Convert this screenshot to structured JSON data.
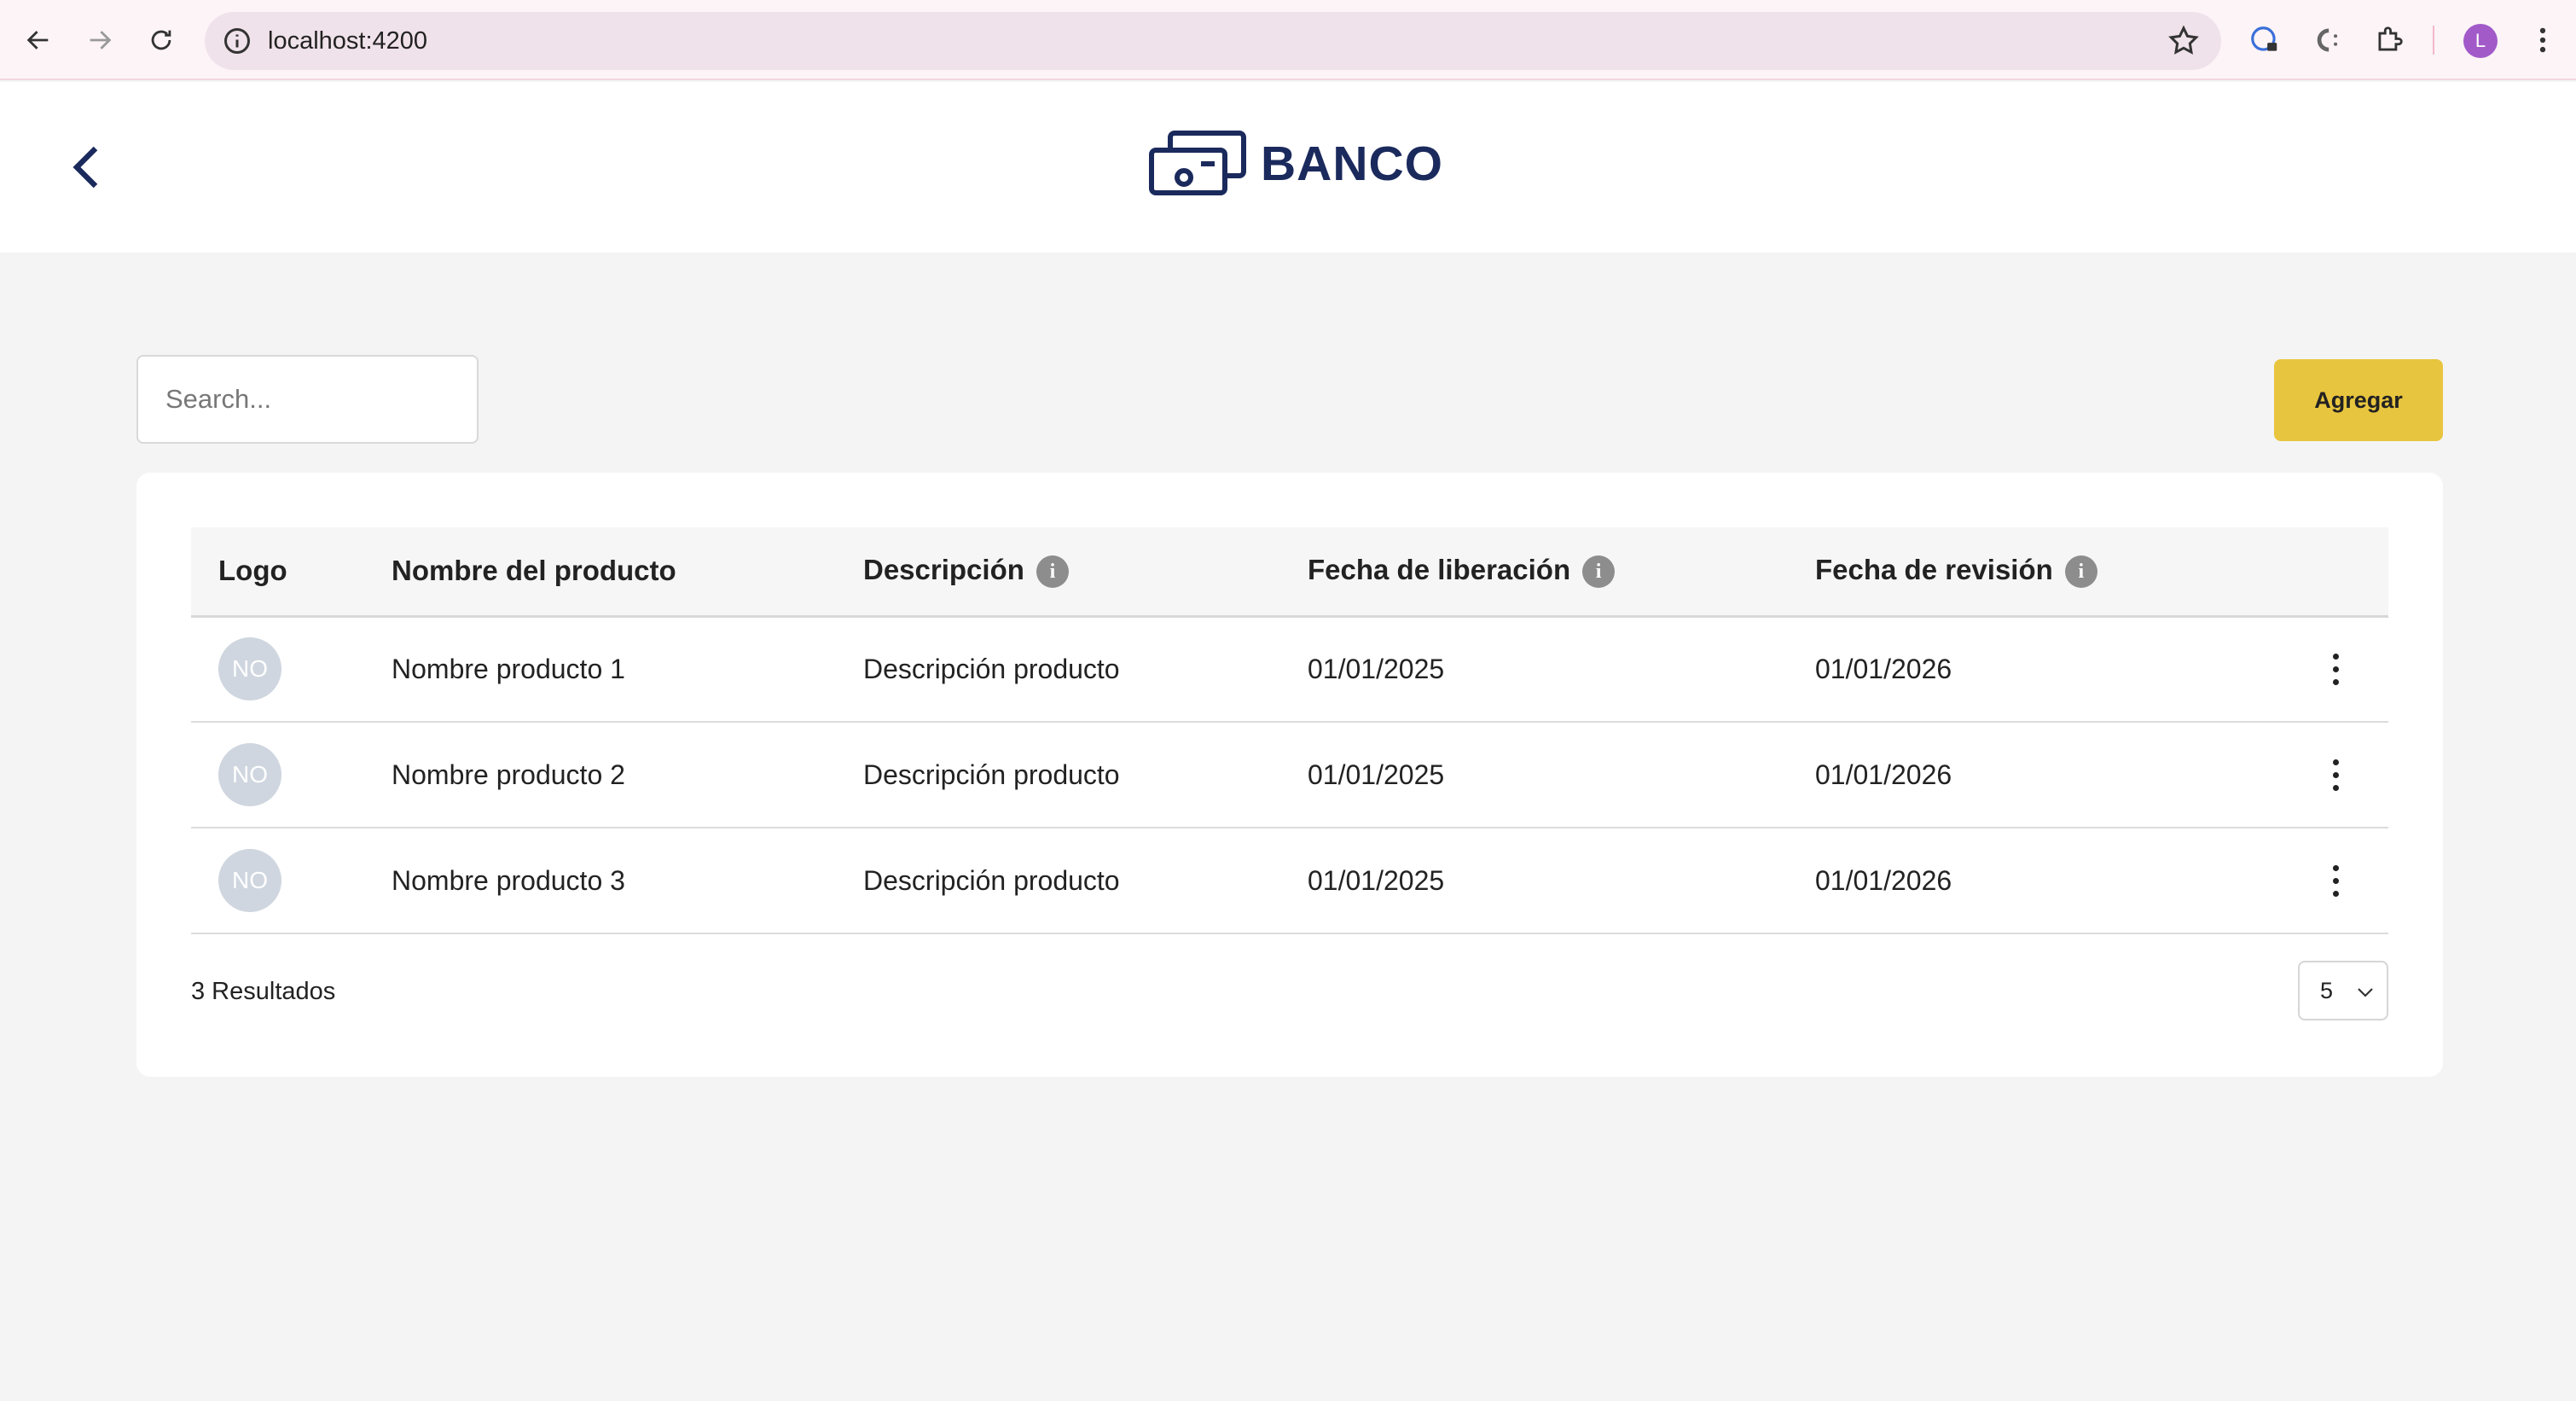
{
  "browser": {
    "url": "localhost:4200",
    "profile_initial": "L"
  },
  "header": {
    "brand": "BANCO"
  },
  "toolbar": {
    "search_placeholder": "Search...",
    "add_label": "Agregar"
  },
  "table": {
    "columns": [
      "Logo",
      "Nombre del producto",
      "Descripción",
      "Fecha de liberación",
      "Fecha de revisión"
    ],
    "info_glyph": "i",
    "rows": [
      {
        "logo": "NO",
        "name": "Nombre producto 1",
        "description": "Descripción producto",
        "release": "01/01/2025",
        "revision": "01/01/2026"
      },
      {
        "logo": "NO",
        "name": "Nombre producto 2",
        "description": "Descripción producto",
        "release": "01/01/2025",
        "revision": "01/01/2026"
      },
      {
        "logo": "NO",
        "name": "Nombre producto 3",
        "description": "Descripción producto",
        "release": "01/01/2025",
        "revision": "01/01/2026"
      }
    ]
  },
  "footer": {
    "results": "3 Resultados",
    "page_size": "5"
  },
  "colors": {
    "brand": "#1b2a5c",
    "accent": "#e8c53e",
    "badge": "#cfd6df",
    "avatar": "#a25ac9"
  },
  "icons": [
    "back-arrow-icon",
    "forward-arrow-icon",
    "reload-icon",
    "site-info-icon",
    "star-icon",
    "password-manager-icon",
    "extension-icon",
    "puzzle-icon",
    "kebab-menu-icon",
    "money-logo-icon",
    "chevron-left-icon",
    "info-icon",
    "chevron-down-icon"
  ]
}
